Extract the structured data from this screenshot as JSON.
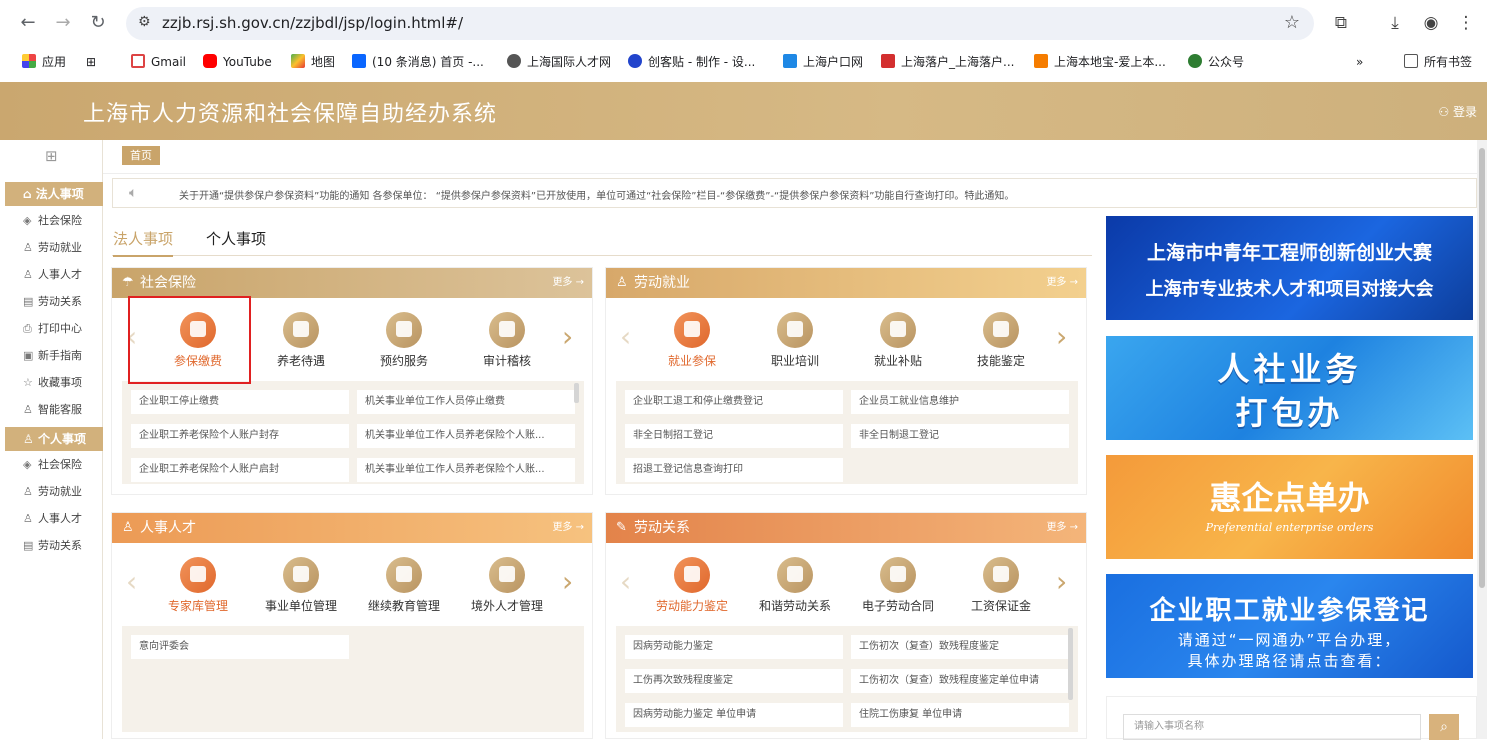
{
  "browser": {
    "url": "zzjb.rsj.sh.gov.cn/zzjbdl/jsp/login.html#/",
    "bookmarks": [
      "应用",
      "Gmail",
      "YouTube",
      "地图",
      "(10 条消息) 首页 -...",
      "上海国际人才网",
      "创客贴 - 制作 - 设...",
      "上海户口网",
      "上海落户_上海落户...",
      "上海本地宝-爱上本...",
      "公众号",
      "所有书签"
    ],
    "more_bookmarks": "»"
  },
  "header": {
    "title": "上海市人力资源和社会保障自助经办系统",
    "login": "登录"
  },
  "sidebar": {
    "section1": "法人事项",
    "items1": [
      "社会保险",
      "劳动就业",
      "人事人才",
      "劳动关系",
      "打印中心",
      "新手指南",
      "收藏事项",
      "智能客服"
    ],
    "section2": "个人事项",
    "items2": [
      "社会保险",
      "劳动就业",
      "人事人才",
      "劳动关系"
    ]
  },
  "breadcrumb": "首页",
  "notice": "关于开通“提供参保户参保资料”功能的通知 各参保单位： “提供参保户参保资料”已开放使用，单位可通过“社会保险”栏目-“参保缴费”-“提供参保户参保资料”功能自行查询打印。特此通知。",
  "tabs": [
    "法人事项",
    "个人事项"
  ],
  "more_label": "更多 →",
  "cards": {
    "social": {
      "title": "社会保险",
      "services": [
        "参保缴费",
        "养老待遇",
        "预约服务",
        "审计稽核"
      ],
      "items": [
        "企业职工停止缴费",
        "机关事业单位工作人员停止缴费",
        "企业职工养老保险个人账户封存",
        "机关事业单位工作人员养老保险个人账...",
        "企业职工养老保险个人账户启封",
        "机关事业单位工作人员养老保险个人账..."
      ]
    },
    "employment": {
      "title": "劳动就业",
      "services": [
        "就业参保",
        "职业培训",
        "就业补贴",
        "技能鉴定"
      ],
      "items": [
        "企业职工退工和停止缴费登记",
        "企业员工就业信息维护",
        "非全日制招工登记",
        "非全日制退工登记",
        "招退工登记信息查询打印"
      ]
    },
    "talent": {
      "title": "人事人才",
      "services": [
        "专家库管理",
        "事业单位管理",
        "继续教育管理",
        "境外人才管理"
      ],
      "items": [
        "意向评委会"
      ]
    },
    "relations": {
      "title": "劳动关系",
      "services": [
        "劳动能力鉴定",
        "和谐劳动关系",
        "电子劳动合同",
        "工资保证金"
      ],
      "items": [
        "因病劳动能力鉴定",
        "工伤初次（复查）致残程度鉴定",
        "工伤再次致残程度鉴定",
        "工伤初次（复查）致残程度鉴定单位申请",
        "因病劳动能力鉴定 单位申请",
        "住院工伤康复 单位申请"
      ]
    }
  },
  "banners": [
    {
      "line1": "上海市中青年工程师创新创业大赛",
      "line2": "上海市专业技术人才和项目对接大会"
    },
    {
      "line1": "人社业务",
      "line2": "打包办"
    },
    {
      "line1": "惠企点单办",
      "line2": "Preferential enterprise orders"
    },
    {
      "line1": "企业职工就业参保登记",
      "line2": "请通过“一网通办”平台办理，",
      "line3": "具体办理路径请点击查看："
    }
  ],
  "search": {
    "placeholder": "请输入事项名称"
  },
  "colors": {
    "gold": "#c9a46a",
    "orange": "#e0682d",
    "header": "#d2b17c"
  }
}
